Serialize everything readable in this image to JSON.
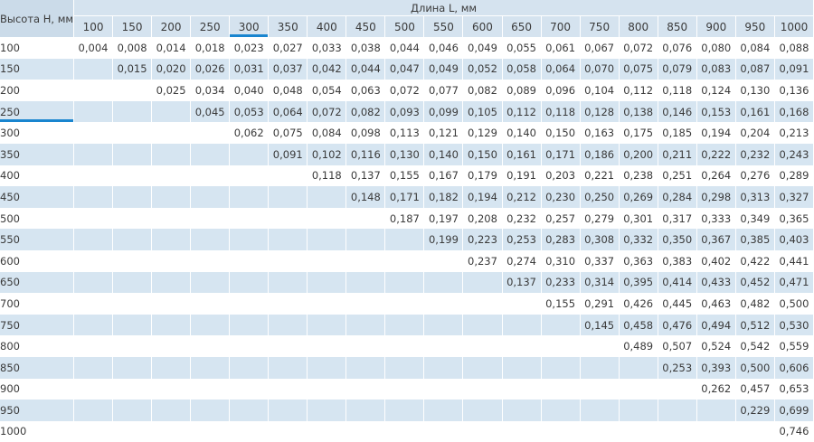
{
  "header": {
    "height_label": "Высота H, мм",
    "length_label": "Длина L, мм"
  },
  "columns": [
    "100",
    "150",
    "200",
    "250",
    "300",
    "350",
    "400",
    "450",
    "500",
    "550",
    "600",
    "650",
    "700",
    "750",
    "800",
    "850",
    "900",
    "950",
    "1000"
  ],
  "highlight": {
    "column": "300",
    "row": "250",
    "accent_color": "#1985cf",
    "band_color": "#d6e5f1",
    "header_color": "#d5e3ef"
  },
  "rows": [
    {
      "h": "100",
      "values": [
        "0,004",
        "0,008",
        "0,014",
        "0,018",
        "0,023",
        "0,027",
        "0,033",
        "0,038",
        "0,044",
        "0,046",
        "0,049",
        "0,055",
        "0,061",
        "0,067",
        "0,072",
        "0,076",
        "0,080",
        "0,084",
        "0,088"
      ]
    },
    {
      "h": "150",
      "values": [
        "",
        "0,015",
        "0,020",
        "0,026",
        "0,031",
        "0,037",
        "0,042",
        "0,044",
        "0,047",
        "0,049",
        "0,052",
        "0,058",
        "0,064",
        "0,070",
        "0,075",
        "0,079",
        "0,083",
        "0,087",
        "0,091"
      ]
    },
    {
      "h": "200",
      "values": [
        "",
        "",
        "0,025",
        "0,034",
        "0,040",
        "0,048",
        "0,054",
        "0,063",
        "0,072",
        "0,077",
        "0,082",
        "0,089",
        "0,096",
        "0,104",
        "0,112",
        "0,118",
        "0,124",
        "0,130",
        "0,136"
      ]
    },
    {
      "h": "250",
      "values": [
        "",
        "",
        "",
        "0,045",
        "0,053",
        "0,064",
        "0,072",
        "0,082",
        "0,093",
        "0,099",
        "0,105",
        "0,112",
        "0,118",
        "0,128",
        "0,138",
        "0,146",
        "0,153",
        "0,161",
        "0,168"
      ]
    },
    {
      "h": "300",
      "values": [
        "",
        "",
        "",
        "",
        "0,062",
        "0,075",
        "0,084",
        "0,098",
        "0,113",
        "0,121",
        "0,129",
        "0,140",
        "0,150",
        "0,163",
        "0,175",
        "0,185",
        "0,194",
        "0,204",
        "0,213"
      ]
    },
    {
      "h": "350",
      "values": [
        "",
        "",
        "",
        "",
        "",
        "0,091",
        "0,102",
        "0,116",
        "0,130",
        "0,140",
        "0,150",
        "0,161",
        "0,171",
        "0,186",
        "0,200",
        "0,211",
        "0,222",
        "0,232",
        "0,243"
      ]
    },
    {
      "h": "400",
      "values": [
        "",
        "",
        "",
        "",
        "",
        "",
        "0,118",
        "0,137",
        "0,155",
        "0,167",
        "0,179",
        "0,191",
        "0,203",
        "0,221",
        "0,238",
        "0,251",
        "0,264",
        "0,276",
        "0,289"
      ]
    },
    {
      "h": "450",
      "values": [
        "",
        "",
        "",
        "",
        "",
        "",
        "",
        "0,148",
        "0,171",
        "0,182",
        "0,194",
        "0,212",
        "0,230",
        "0,250",
        "0,269",
        "0,284",
        "0,298",
        "0,313",
        "0,327"
      ]
    },
    {
      "h": "500",
      "values": [
        "",
        "",
        "",
        "",
        "",
        "",
        "",
        "",
        "0,187",
        "0,197",
        "0,208",
        "0,232",
        "0,257",
        "0,279",
        "0,301",
        "0,317",
        "0,333",
        "0,349",
        "0,365"
      ]
    },
    {
      "h": "550",
      "values": [
        "",
        "",
        "",
        "",
        "",
        "",
        "",
        "",
        "",
        "0,199",
        "0,223",
        "0,253",
        "0,283",
        "0,308",
        "0,332",
        "0,350",
        "0,367",
        "0,385",
        "0,403"
      ]
    },
    {
      "h": "600",
      "values": [
        "",
        "",
        "",
        "",
        "",
        "",
        "",
        "",
        "",
        "",
        "0,237",
        "0,274",
        "0,310",
        "0,337",
        "0,363",
        "0,383",
        "0,402",
        "0,422",
        "0,441"
      ]
    },
    {
      "h": "650",
      "values": [
        "",
        "",
        "",
        "",
        "",
        "",
        "",
        "",
        "",
        "",
        "",
        "0,137",
        "0,233",
        "0,314",
        "0,395",
        "0,414",
        "0,433",
        "0,452",
        "0,471"
      ]
    },
    {
      "h": "700",
      "values": [
        "",
        "",
        "",
        "",
        "",
        "",
        "",
        "",
        "",
        "",
        "",
        "",
        "0,155",
        "0,291",
        "0,426",
        "0,445",
        "0,463",
        "0,482",
        "0,500"
      ]
    },
    {
      "h": "750",
      "values": [
        "",
        "",
        "",
        "",
        "",
        "",
        "",
        "",
        "",
        "",
        "",
        "",
        "",
        "0,145",
        "0,458",
        "0,476",
        "0,494",
        "0,512",
        "0,530"
      ]
    },
    {
      "h": "800",
      "values": [
        "",
        "",
        "",
        "",
        "",
        "",
        "",
        "",
        "",
        "",
        "",
        "",
        "",
        "",
        "0,489",
        "0,507",
        "0,524",
        "0,542",
        "0,559"
      ]
    },
    {
      "h": "850",
      "values": [
        "",
        "",
        "",
        "",
        "",
        "",
        "",
        "",
        "",
        "",
        "",
        "",
        "",
        "",
        "",
        "0,253",
        "0,393",
        "0,500",
        "0,606"
      ]
    },
    {
      "h": "900",
      "values": [
        "",
        "",
        "",
        "",
        "",
        "",
        "",
        "",
        "",
        "",
        "",
        "",
        "",
        "",
        "",
        "",
        "0,262",
        "0,457",
        "0,653"
      ]
    },
    {
      "h": "950",
      "values": [
        "",
        "",
        "",
        "",
        "",
        "",
        "",
        "",
        "",
        "",
        "",
        "",
        "",
        "",
        "",
        "",
        "",
        "0,229",
        "0,699"
      ]
    },
    {
      "h": "1000",
      "values": [
        "",
        "",
        "",
        "",
        "",
        "",
        "",
        "",
        "",
        "",
        "",
        "",
        "",
        "",
        "",
        "",
        "",
        "",
        "0,746"
      ]
    }
  ]
}
